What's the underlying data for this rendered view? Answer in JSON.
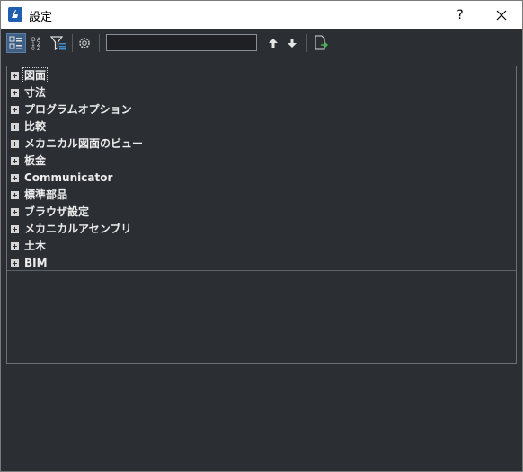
{
  "window": {
    "title": "設定",
    "help_label": "?",
    "close_label": "✕"
  },
  "toolbar": {
    "tools": [
      {
        "icon": "categorized-view-icon",
        "active": true
      },
      {
        "icon": "alphabetical-sort-icon",
        "active": false
      },
      {
        "icon": "filter-icon",
        "active": false
      },
      {
        "icon": "gear-icon",
        "active": false
      },
      {
        "icon": "arrow-up-icon",
        "active": false
      },
      {
        "icon": "arrow-down-icon",
        "active": false
      },
      {
        "icon": "export-icon",
        "active": false
      }
    ],
    "search_value": ""
  },
  "tree": {
    "items": [
      {
        "label": "図面"
      },
      {
        "label": "寸法"
      },
      {
        "label": "プログラムオプション"
      },
      {
        "label": "比較"
      },
      {
        "label": "メカニカル図面のビュー"
      },
      {
        "label": "板金"
      },
      {
        "label": "Communicator"
      },
      {
        "label": "標準部品"
      },
      {
        "label": "ブラウザ設定"
      },
      {
        "label": "メカニカルアセンブリ"
      },
      {
        "label": "土木"
      },
      {
        "label": "BIM"
      }
    ]
  }
}
